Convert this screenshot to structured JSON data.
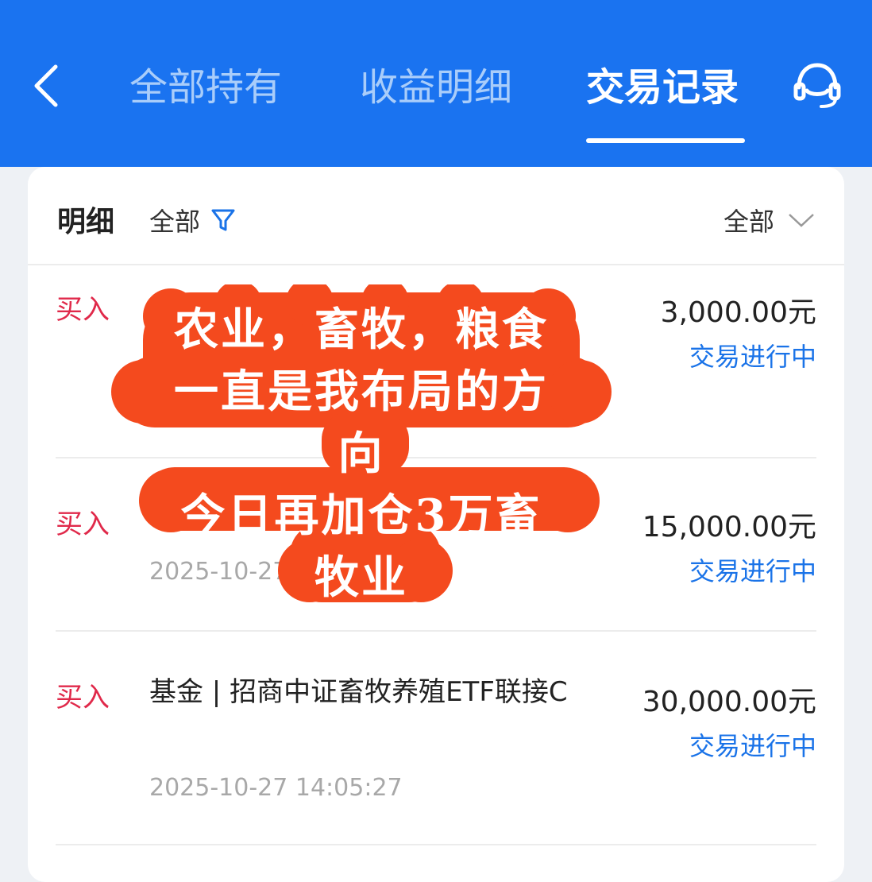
{
  "header": {
    "tabs": [
      {
        "label": "全部持有",
        "active": false
      },
      {
        "label": "收益明细",
        "active": false
      },
      {
        "label": "交易记录",
        "active": true
      }
    ],
    "icons": {
      "back": "chevron-left-icon",
      "service": "headset-icon"
    },
    "colors": {
      "bar": "#1a73f0",
      "tab_inactive": "#a9cdfa",
      "tab_active": "#ffffff"
    }
  },
  "card": {
    "title": "明细",
    "filter_label": "全部",
    "sort_label": "全部"
  },
  "transactions": [
    {
      "type": "买入",
      "name": "",
      "time": "",
      "amount": "3,000.00元",
      "status": "交易进行中"
    },
    {
      "type": "买入",
      "name": "",
      "time": "2025-10-27",
      "amount": "15,000.00元",
      "status": "交易进行中"
    },
    {
      "type": "买入",
      "name": "基金 | 招商中证畜牧养殖ETF联接C",
      "time": "2025-10-27 14:05:27",
      "amount": "30,000.00元",
      "status": "交易进行中"
    }
  ],
  "overlay": {
    "lines": [
      "农业，畜牧，粮食",
      "一直是我布局的方",
      "向",
      "今日再加仓3万畜",
      "牧业"
    ],
    "color": "#f44a1e"
  },
  "status_colors": {
    "buy": "#e0294a",
    "pending": "#1a73e8"
  }
}
